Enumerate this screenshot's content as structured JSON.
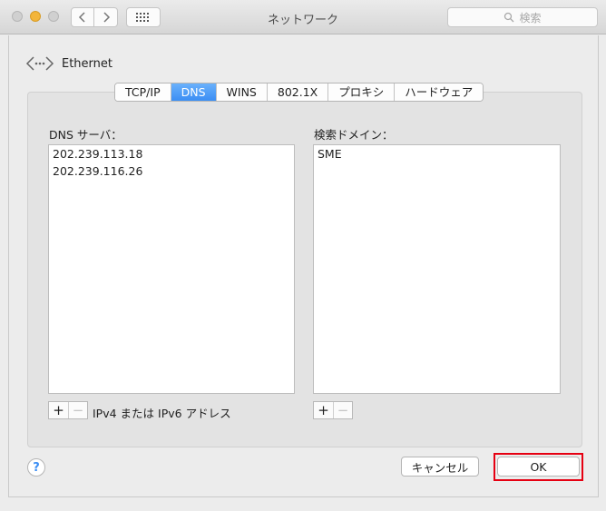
{
  "window": {
    "title": "ネットワーク",
    "search_placeholder": "検索"
  },
  "device": {
    "label": "Ethernet"
  },
  "tabs": [
    "TCP/IP",
    "DNS",
    "WINS",
    "802.1X",
    "プロキシ",
    "ハードウェア"
  ],
  "active_tab": "DNS",
  "dns": {
    "label": "DNS サーバ：",
    "servers": [
      "202.239.113.18",
      "202.239.116.26"
    ],
    "hint": "IPv4 または IPv6 アドレス"
  },
  "search_domains": {
    "label": "検索ドメイン：",
    "domains": [
      "SME"
    ]
  },
  "buttons": {
    "add": "+",
    "remove": "−",
    "help": "?",
    "cancel": "キャンセル",
    "ok": "OK"
  },
  "colors": {
    "accent": "#3b8ef4",
    "highlight": "#e60012"
  }
}
